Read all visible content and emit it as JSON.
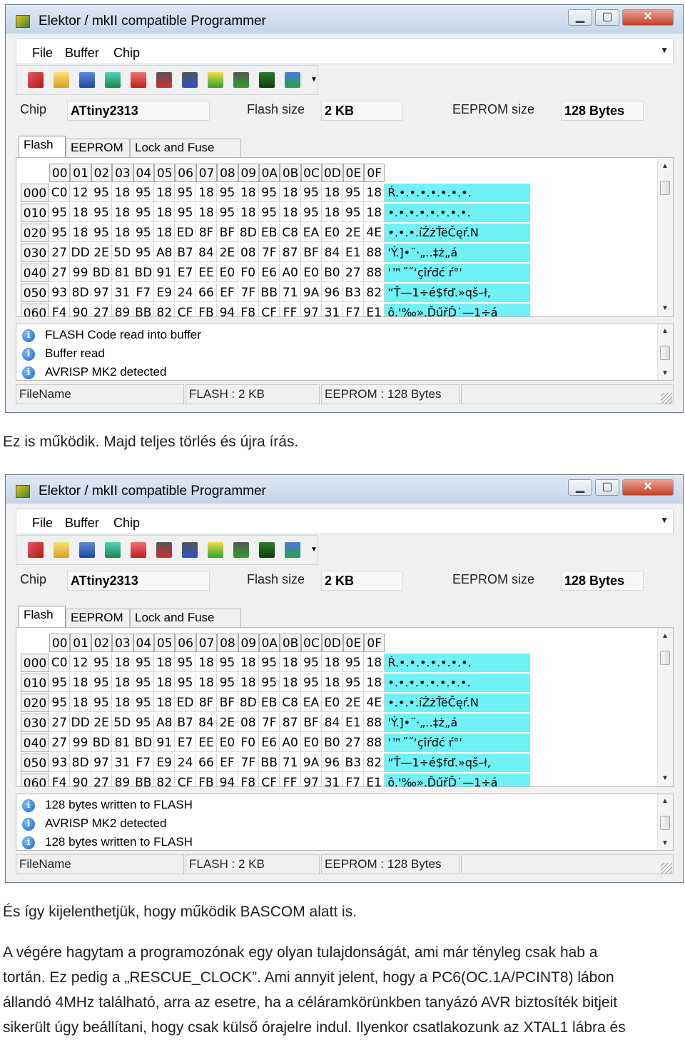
{
  "windows": [
    {
      "title": "Elektor / mkII compatible Programmer",
      "menu": [
        "File",
        "Buffer",
        "Chip"
      ],
      "chip_label": "Chip",
      "chip_value": "ATtiny2313",
      "flash_label": "Flash size",
      "flash_value": "2 KB",
      "eeprom_label": "EEPROM size",
      "eeprom_value": "128 Bytes",
      "tabs": [
        "Flash",
        "EEPROM",
        "Lock and Fuse bits"
      ],
      "log": [
        "FLASH Code read into buffer",
        "Buffer read",
        "AVRISP MK2 detected"
      ],
      "status": [
        "FileName",
        "FLASH : 2 KB",
        "EEPROM : 128 Bytes"
      ]
    },
    {
      "title": "Elektor / mkII compatible Programmer",
      "menu": [
        "File",
        "Buffer",
        "Chip"
      ],
      "chip_label": "Chip",
      "chip_value": "ATtiny2313",
      "flash_label": "Flash size",
      "flash_value": "2 KB",
      "eeprom_label": "EEPROM size",
      "eeprom_value": "128 Bytes",
      "tabs": [
        "Flash",
        "EEPROM",
        "Lock and Fuse bits"
      ],
      "log": [
        "128 bytes written to FLASH",
        "AVRISP MK2 detected",
        "128 bytes written to FLASH"
      ],
      "status": [
        "FileName",
        "FLASH : 2 KB",
        "EEPROM : 128 Bytes"
      ]
    }
  ],
  "hex": {
    "columns": [
      "00",
      "01",
      "02",
      "03",
      "04",
      "05",
      "06",
      "07",
      "08",
      "09",
      "0A",
      "0B",
      "0C",
      "0D",
      "0E",
      "0F"
    ],
    "rows": [
      {
        "addr": "000",
        "bytes": [
          "C0",
          "12",
          "95",
          "18",
          "95",
          "18",
          "95",
          "18",
          "95",
          "18",
          "95",
          "18",
          "95",
          "18",
          "95",
          "18"
        ],
        "ascii": "Ŕ.•.•.•.•.•.•.•."
      },
      {
        "addr": "010",
        "bytes": [
          "95",
          "18",
          "95",
          "18",
          "95",
          "18",
          "95",
          "18",
          "95",
          "18",
          "95",
          "18",
          "95",
          "18",
          "95",
          "18"
        ],
        "ascii": "•.•.•.•.•.•.•.•."
      },
      {
        "addr": "020",
        "bytes": [
          "95",
          "18",
          "95",
          "18",
          "95",
          "18",
          "ED",
          "8F",
          "BF",
          "8D",
          "EB",
          "C8",
          "EA",
          "E0",
          "2E",
          "4E"
        ],
        "ascii": "•.•.•.íŹżŤëČęŕ.N"
      },
      {
        "addr": "030",
        "bytes": [
          "27",
          "DD",
          "2E",
          "5D",
          "95",
          "A8",
          "B7",
          "84",
          "2E",
          "08",
          "7F",
          "87",
          "BF",
          "84",
          "E1",
          "88"
        ],
        "ascii": "'Ý.]•¨·„..‡ż„á"
      },
      {
        "addr": "040",
        "bytes": [
          "27",
          "99",
          "BD",
          "81",
          "BD",
          "91",
          "E7",
          "EE",
          "E0",
          "F0",
          "E6",
          "A0",
          "E0",
          "B0",
          "27",
          "88"
        ],
        "ascii": "'™˝˝‘çîŕđć ŕ°'"
      },
      {
        "addr": "050",
        "bytes": [
          "93",
          "8D",
          "97",
          "31",
          "F7",
          "E9",
          "24",
          "66",
          "EF",
          "7F",
          "BB",
          "71",
          "9A",
          "96",
          "B3",
          "82"
        ],
        "ascii": "“Ť—1÷é$fď.»qš–ł‚"
      },
      {
        "addr": "060",
        "bytes": [
          "F4",
          "90",
          "27",
          "89",
          "BB",
          "82",
          "CF",
          "FB",
          "94",
          "F8",
          "CF",
          "FF",
          "97",
          "31",
          "F7",
          "E1"
        ],
        "ascii": "ô.'‰»‚ĎűřĎ˙—1÷á"
      }
    ]
  },
  "text": {
    "line1": "Ez is működik. Majd teljes törlés és újra írás.",
    "line2": "És így kijelenthetjük, hogy működik BASCOM alatt is.",
    "line3": "A végére hagytam a programozónak egy olyan tulajdonságát, ami már tényleg csak hab a",
    "line4": "tortán. Ez pedig a „RESCUE_CLOCK”. Ami annyit jelent, hogy a PC6(OC.1A/PCINT8) lábon",
    "line5": "állandó 4MHz található, arra az esetre, ha a céláramkörünkben tanyázó AVR biztosíték bitjeit",
    "line6": "sikerült úgy beállítani, hogy csak külső órajelre indul. Ilyenkor csatlakozunk az XTAL1 lábra és"
  },
  "colors": {
    "ascii_bg": "#6ff1f5",
    "title_bg": "#c3d5ea"
  }
}
